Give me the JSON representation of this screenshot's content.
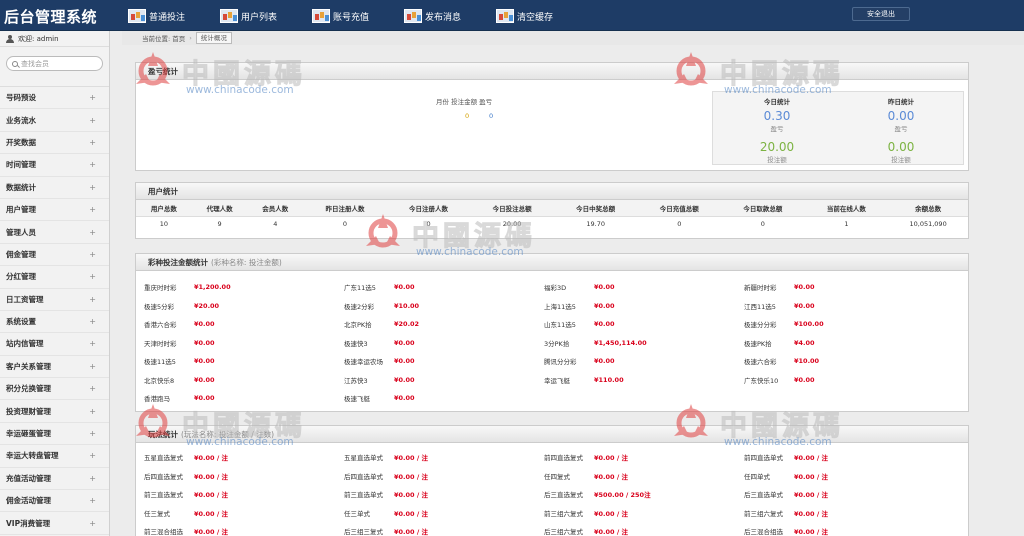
{
  "app": {
    "title": "后台管理系统"
  },
  "topnav": [
    {
      "label": "普通投注",
      "icon": "chart-icon"
    },
    {
      "label": "用户列表",
      "icon": "chart-icon"
    },
    {
      "label": "账号充值",
      "icon": "chart-icon"
    },
    {
      "label": "发布消息",
      "icon": "chart-icon"
    },
    {
      "label": "清空缓存",
      "icon": "chart-icon"
    }
  ],
  "header": {
    "logout_label": "安全退出"
  },
  "sidebar": {
    "welcome": "欢迎: admin",
    "search_placeholder": "查找会员",
    "items": [
      {
        "label": "号码预设"
      },
      {
        "label": "业务流水"
      },
      {
        "label": "开奖数据"
      },
      {
        "label": "时间管理"
      },
      {
        "label": "数据统计"
      },
      {
        "label": "用户管理"
      },
      {
        "label": "管理人员"
      },
      {
        "label": "佣金管理"
      },
      {
        "label": "分红管理"
      },
      {
        "label": "日工资管理"
      },
      {
        "label": "系统设置"
      },
      {
        "label": "站内信管理"
      },
      {
        "label": "客户关系管理"
      },
      {
        "label": "积分兑换管理"
      },
      {
        "label": "投资理财管理"
      },
      {
        "label": "幸运砸蛋管理"
      },
      {
        "label": "幸运大转盘管理"
      },
      {
        "label": "充值活动管理"
      },
      {
        "label": "佣金活动管理"
      },
      {
        "label": "VIP消费管理"
      }
    ],
    "expand_symbol": "+"
  },
  "breadcrumb": {
    "prefix": "当前位置:",
    "home": "首页",
    "sep": "›",
    "current": "统计概况"
  },
  "profit": {
    "title": "盈亏统计",
    "legend": "月份 投注金额 盈亏",
    "value_a": "0",
    "value_b": "0",
    "today": {
      "title": "今日统计",
      "profit": "0.30",
      "profit_label": "盈亏",
      "bet": "20.00",
      "bet_label": "投注额"
    },
    "yesterday": {
      "title": "昨日统计",
      "profit": "0.00",
      "profit_label": "盈亏",
      "bet": "0.00",
      "bet_label": "投注额"
    }
  },
  "users": {
    "title": "用户统计",
    "headers": [
      "用户总数",
      "代理人数",
      "会员人数",
      "昨日注册人数",
      "今日注册人数",
      "今日投注总额",
      "今日中奖总额",
      "今日充值总额",
      "今日取款总额",
      "当前在线人数",
      "余额总数"
    ],
    "values": [
      "10",
      "9",
      "4",
      "0",
      "0",
      "20.00",
      "19.70",
      "0",
      "0",
      "1",
      "10,051,090"
    ]
  },
  "lottery": {
    "title": "彩种投注金额统计",
    "subtitle": "(彩种名称: 投注金额)",
    "items": [
      {
        "name": "重庆时时彩",
        "value": "¥1,200.00"
      },
      {
        "name": "广东11选5",
        "value": "¥0.00"
      },
      {
        "name": "福彩3D",
        "value": "¥0.00"
      },
      {
        "name": "新疆时时彩",
        "value": "¥0.00"
      },
      {
        "name": "极速5分彩",
        "value": "¥20.00"
      },
      {
        "name": "极速2分彩",
        "value": "¥10.00"
      },
      {
        "name": "上海11选5",
        "value": "¥0.00"
      },
      {
        "name": "江西11选5",
        "value": "¥0.00"
      },
      {
        "name": "香港六合彩",
        "value": "¥0.00"
      },
      {
        "name": "北京PK拾",
        "value": "¥20.02"
      },
      {
        "name": "山东11选5",
        "value": "¥0.00"
      },
      {
        "name": "极速分分彩",
        "value": "¥100.00"
      },
      {
        "name": "天津时时彩",
        "value": "¥0.00"
      },
      {
        "name": "极速快3",
        "value": "¥0.00"
      },
      {
        "name": "3分PK拾",
        "value": "¥1,450,114.00"
      },
      {
        "name": "极速PK拾",
        "value": "¥4.00"
      },
      {
        "name": "极速11选5",
        "value": "¥0.00"
      },
      {
        "name": "极速幸运农场",
        "value": "¥0.00"
      },
      {
        "name": "腾讯分分彩",
        "value": "¥0.00"
      },
      {
        "name": "极速六合彩",
        "value": "¥10.00"
      },
      {
        "name": "北京快乐8",
        "value": "¥0.00"
      },
      {
        "name": "江苏快3",
        "value": "¥0.00"
      },
      {
        "name": "幸运飞艇",
        "value": "¥110.00"
      },
      {
        "name": "广东快乐10",
        "value": "¥0.00"
      },
      {
        "name": "香港跑马",
        "value": "¥0.00"
      },
      {
        "name": "极速飞艇",
        "value": "¥0.00"
      }
    ]
  },
  "play": {
    "title": "玩法统计",
    "subtitle": "(玩法名称: 投注金额 / 注数)",
    "items": [
      {
        "name": "五星直选复式",
        "value": "¥0.00 / 注"
      },
      {
        "name": "五星直选单式",
        "value": "¥0.00 / 注"
      },
      {
        "name": "前四直选复式",
        "value": "¥0.00 / 注"
      },
      {
        "name": "前四直选单式",
        "value": "¥0.00 / 注"
      },
      {
        "name": "后四直选复式",
        "value": "¥0.00 / 注"
      },
      {
        "name": "后四直选单式",
        "value": "¥0.00 / 注"
      },
      {
        "name": "任四复式",
        "value": "¥0.00 / 注"
      },
      {
        "name": "任四单式",
        "value": "¥0.00 / 注"
      },
      {
        "name": "前三直选复式",
        "value": "¥0.00 / 注"
      },
      {
        "name": "前三直选单式",
        "value": "¥0.00 / 注"
      },
      {
        "name": "后三直选复式",
        "value": "¥500.00 / 250注"
      },
      {
        "name": "后三直选单式",
        "value": "¥0.00 / 注"
      },
      {
        "name": "任三复式",
        "value": "¥0.00 / 注"
      },
      {
        "name": "任三单式",
        "value": "¥0.00 / 注"
      },
      {
        "name": "前三组六复式",
        "value": "¥0.00 / 注"
      },
      {
        "name": "前三组六复式",
        "value": "¥0.00 / 注"
      },
      {
        "name": "前三混合组选",
        "value": "¥0.00 / 注"
      },
      {
        "name": "后三组三复式",
        "value": "¥0.00 / 注"
      },
      {
        "name": "后三组六复式",
        "value": "¥0.00 / 注"
      },
      {
        "name": "后三混合组选",
        "value": "¥0.00 / 注"
      }
    ]
  },
  "watermark": {
    "cn": "中國源碼",
    "url": "www.chinacode.com"
  }
}
